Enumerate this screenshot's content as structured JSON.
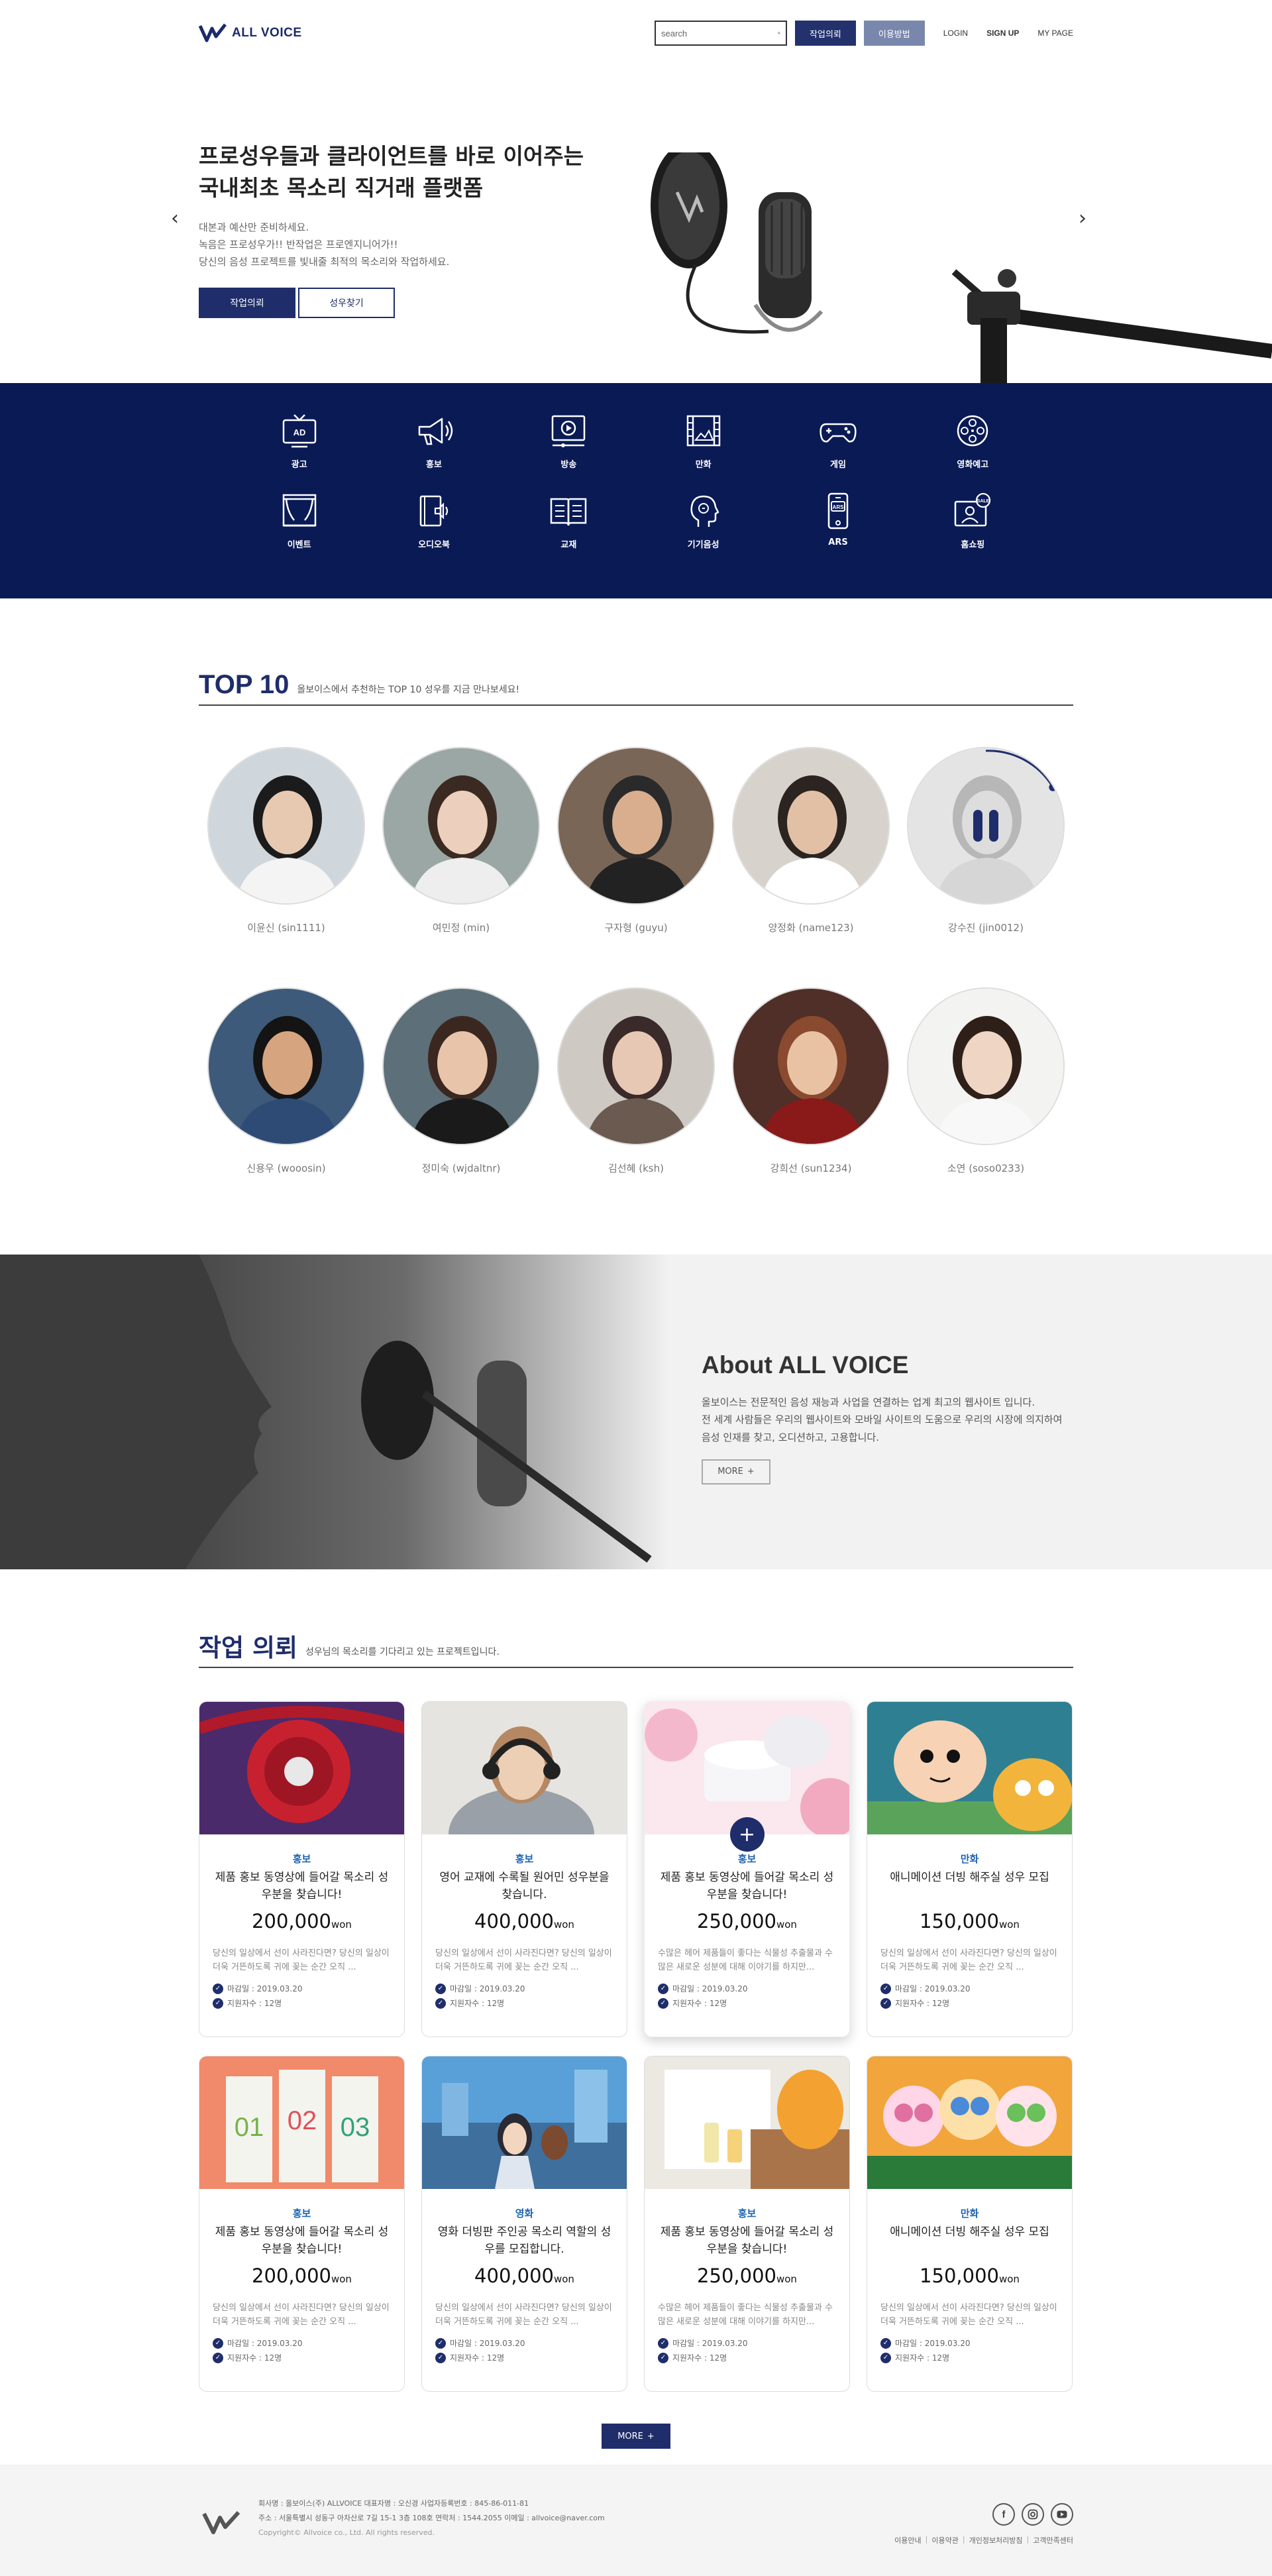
{
  "header": {
    "brand": "ALL VOICE",
    "search_placeholder": "search",
    "request_button": "작업의뢰",
    "howto_button": "이용방법",
    "login": "LOGIN",
    "signup": "SIGN UP",
    "mypage": "MY PAGE"
  },
  "hero": {
    "title_line1": "프로성우들과 클라이언트를 바로 이어주는",
    "title_line2": "국내최초 목소리 직거래 플랫폼",
    "desc_line1": "대본과 예산만 준비하세요.",
    "desc_line2": "녹음은 프로성우가!! 반작업은 프로엔지니어가!!",
    "desc_line3": "당신의 음성 프로젝트를 빛내줄 최적의 목소리와 작업하세요.",
    "primary_button": "작업의뢰",
    "secondary_button": "성우찾기",
    "prev_arrow": "‹",
    "next_arrow": "›"
  },
  "categories": [
    {
      "label": "광고",
      "icon": "tv-ad-icon"
    },
    {
      "label": "홍보",
      "icon": "megaphone-icon"
    },
    {
      "label": "방송",
      "icon": "broadcast-play-icon"
    },
    {
      "label": "만화",
      "icon": "film-icon"
    },
    {
      "label": "게임",
      "icon": "gamepad-icon"
    },
    {
      "label": "영화예고",
      "icon": "film-reel-icon"
    },
    {
      "label": "이벤트",
      "icon": "stage-curtain-icon"
    },
    {
      "label": "오디오북",
      "icon": "audiobook-icon"
    },
    {
      "label": "교재",
      "icon": "book-icon"
    },
    {
      "label": "기기음성",
      "icon": "head-voice-icon"
    },
    {
      "label": "ARS",
      "icon": "ars-phone-icon"
    },
    {
      "label": "홈쇼핑",
      "icon": "home-shopping-icon"
    }
  ],
  "top10": {
    "title": "TOP 10",
    "subtitle": "올보이스에서 추천하는 TOP 10 성우를 지금 만나보세요!",
    "actors": [
      {
        "name": "이윤신 (sin1111)"
      },
      {
        "name": "여민정 (min)"
      },
      {
        "name": "구자형 (guyu)"
      },
      {
        "name": "양정화 (name123)"
      },
      {
        "name": "강수진 (jin0012)"
      },
      {
        "name": "신용우 (wooosin)"
      },
      {
        "name": "정미숙 (wjdaltnr)"
      },
      {
        "name": "김선혜 (ksh)"
      },
      {
        "name": "강희선 (sun1234)"
      },
      {
        "name": "소연 (soso0233)"
      }
    ]
  },
  "about": {
    "title": "About ALL VOICE",
    "line1": "올보이스는 전문적인 음성 재능과 사업을 연결하는 업계 최고의 웹사이트 입니다.",
    "line2": "전 세계 사람들은 우리의 웹사이트와 모바일 사이트의 도움으로 우리의 시장에 의지하여",
    "line3": "음성 인재를 찾고, 오디션하고, 고용합니다.",
    "more": "MORE"
  },
  "jobs": {
    "title": "작업 의뢰",
    "subtitle": "성우님의 목소리를 기다리고 있는 프로젝트입니다.",
    "more": "MORE",
    "deadline_prefix": "마감일 : 2019.03.20",
    "applicants": "지원자수 : 12명",
    "cards": [
      {
        "category": "홍보",
        "title": "제품 홍보 동영상에 들어갈 목소리 성우분을 찾습니다!",
        "price": "200,000",
        "unit": "won",
        "desc": "당신의 일상에서 선이 사라진다면? 당신의 일상이 더욱 거뜬하도록 귀에 꽂는 순간 오직 ...",
        "deadline": "마감일 : 2019.03.20",
        "applicants": "지원자수 : 12명"
      },
      {
        "category": "홍보",
        "title": "영어 교재에 수록될 원어민 성우분을 찾습니다.",
        "price": "400,000",
        "unit": "won",
        "desc": "당신의 일상에서 선이 사라진다면? 당신의 일상이 더욱 거뜬하도록 귀에 꽂는 순간 오직 ...",
        "deadline": "마감일 : 2019.03.20",
        "applicants": "지원자수 : 12명"
      },
      {
        "category": "홍보",
        "title": "제품 홍보 동영상에 들어갈 목소리 성우분을 찾습니다!",
        "price": "250,000",
        "unit": "won",
        "desc": "수많은 헤어 제품들이 좋다는 식물성 추출물과 수많은 새로운 성분에 대해 이야기를 하지만...",
        "deadline": "마감일 : 2019.03.20",
        "applicants": "지원자수 : 12명"
      },
      {
        "category": "만화",
        "title": "애니메이션 더빙 해주실 성우 모집",
        "price": "150,000",
        "unit": "won",
        "desc": "당신의 일상에서 선이 사라진다면? 당신의 일상이 더욱 거뜬하도록 귀에 꽂는 순간 오직 ...",
        "deadline": "마감일 : 2019.03.20",
        "applicants": "지원자수 : 12명"
      },
      {
        "category": "홍보",
        "title": "제품 홍보 동영상에 들어갈 목소리 성우분을 찾습니다!",
        "price": "200,000",
        "unit": "won",
        "desc": "당신의 일상에서 선이 사라진다면? 당신의 일상이 더욱 거뜬하도록 귀에 꽂는 순간 오직 ...",
        "deadline": "마감일 : 2019.03.20",
        "applicants": "지원자수 : 12명"
      },
      {
        "category": "영화",
        "title": "영화 더빙판 주인공 목소리 역할의 성우를 모집합니다.",
        "price": "400,000",
        "unit": "won",
        "desc": "당신의 일상에서 선이 사라진다면? 당신의 일상이 더욱 거뜬하도록 귀에 꽂는 순간 오직 ...",
        "deadline": "마감일 : 2019.03.20",
        "applicants": "지원자수 : 12명"
      },
      {
        "category": "홍보",
        "title": "제품 홍보 동영상에 들어갈 목소리 성우분을 찾습니다!",
        "price": "250,000",
        "unit": "won",
        "desc": "수많은 헤어 제품들이 좋다는 식물성 추출물과 수많은 새로운 성분에 대해 이야기를 하지만...",
        "deadline": "마감일 : 2019.03.20",
        "applicants": "지원자수 : 12명"
      },
      {
        "category": "만화",
        "title": "애니메이션 더빙 해주실 성우 모집",
        "price": "150,000",
        "unit": "won",
        "desc": "당신의 일상에서 선이 사라진다면? 당신의 일상이 더욱 거뜬하도록 귀에 꽂는 순간 오직 ...",
        "deadline": "마감일 : 2019.03.20",
        "applicants": "지원자수 : 12명"
      }
    ]
  },
  "footer": {
    "brand": "ALL VOICE",
    "line1": "회사명 : 올보이스(주) ALLVOICE  대표자명 : 오신경  사업자등록번호 : 845-86-011-81",
    "line2": "주소 : 서울특별시 성동구 아차산로 7길 15-1 3층 108호  연락처 : 1544.2055  이메일 : allvoice@naver.com",
    "copyright": "Copyright© Allvoice co., Ltd. All rights reserved.",
    "links": [
      "이용안내",
      "이용약관",
      "개인정보처리방침",
      "고객만족센터"
    ]
  },
  "colors": {
    "navy": "#1f2d6b",
    "band": "#0a1a55",
    "accent_blue": "#1f64b4"
  }
}
